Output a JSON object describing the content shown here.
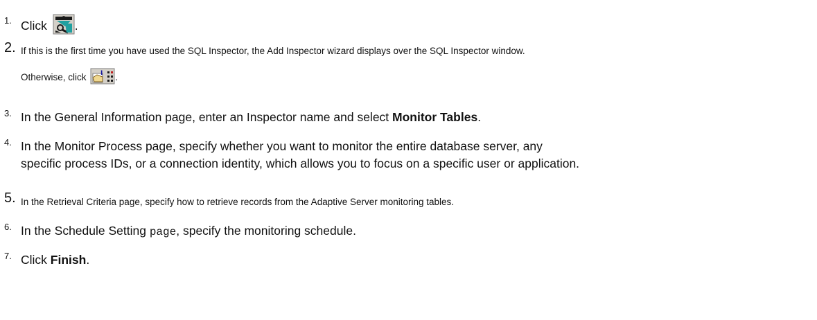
{
  "steps": [
    {
      "num": "1.",
      "text": "Click",
      "end": "."
    },
    {
      "num": "2.",
      "text": "If this is the first time you have used the SQL Inspector, the Add Inspector wizard displays over the SQL Inspector window.",
      "line2": "Otherwise, click",
      "end": "."
    },
    {
      "num": "3.",
      "text": "In the General Information page, enter an Inspector name and select ",
      "bold": "Monitor Tables",
      "end": "."
    },
    {
      "num": "4.",
      "line1": "In the Monitor Process page, specify whether you want to monitor the entire database server, any",
      "line2": "specific process IDs, or a connection identity, which allows you to focus on a specific user or application."
    },
    {
      "num": "5.",
      "text": "In the Retrieval Criteria page, specify how to retrieve records from the Adaptive Server monitoring tables."
    },
    {
      "num": "6.",
      "pre": "In the Schedule Setting ",
      "code": "page",
      "post": ", specify the monitoring schedule."
    },
    {
      "num": "7.",
      "pre": "Click ",
      "bold": "Finish",
      "end": "."
    }
  ],
  "icons": {
    "step1": "sql-inspector-icon",
    "step2": "add-inspector-icon"
  }
}
